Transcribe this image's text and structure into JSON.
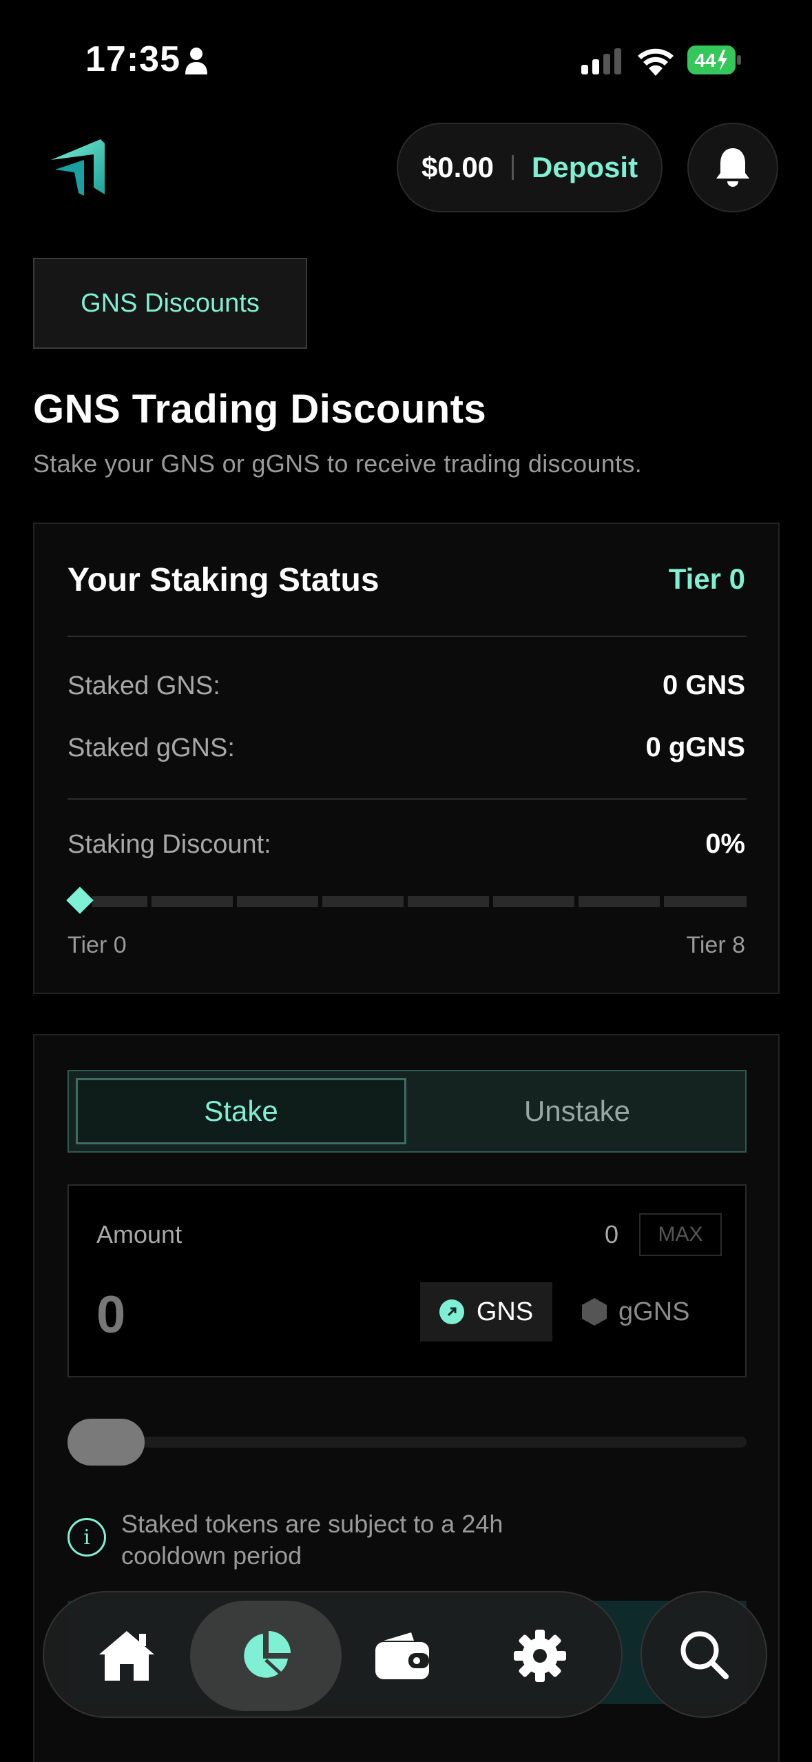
{
  "status_bar": {
    "time": "17:35",
    "battery": "44"
  },
  "header": {
    "balance": "$0.00",
    "deposit_label": "Deposit"
  },
  "tab": {
    "label": "GNS Discounts"
  },
  "page": {
    "title": "GNS Trading Discounts",
    "subtitle": "Stake your GNS or gGNS to receive trading discounts."
  },
  "staking_status": {
    "title": "Your Staking Status",
    "tier": "Tier 0",
    "staked_gns_label": "Staked GNS:",
    "staked_gns_value": "0 GNS",
    "staked_ggns_label": "Staked gGNS:",
    "staked_ggns_value": "0 gGNS",
    "discount_label": "Staking Discount:",
    "discount_value": "0%",
    "tier_min": "Tier 0",
    "tier_max": "Tier 8",
    "progress_fraction": 0
  },
  "stake_form": {
    "stake_label": "Stake",
    "unstake_label": "Unstake",
    "amount_label": "Amount",
    "balance": "0",
    "max_label": "MAX",
    "amount_value": "0",
    "token_gns": "GNS",
    "token_ggns": "gGNS",
    "info_text": "Staked tokens are subject to a 24h cooldown period"
  },
  "colors": {
    "accent": "#7ff0d4",
    "background": "#000000"
  },
  "nav": {
    "items": [
      "home-icon",
      "portfolio-pie-icon",
      "wallet-icon",
      "settings-gear-icon"
    ],
    "active_index": 1
  }
}
